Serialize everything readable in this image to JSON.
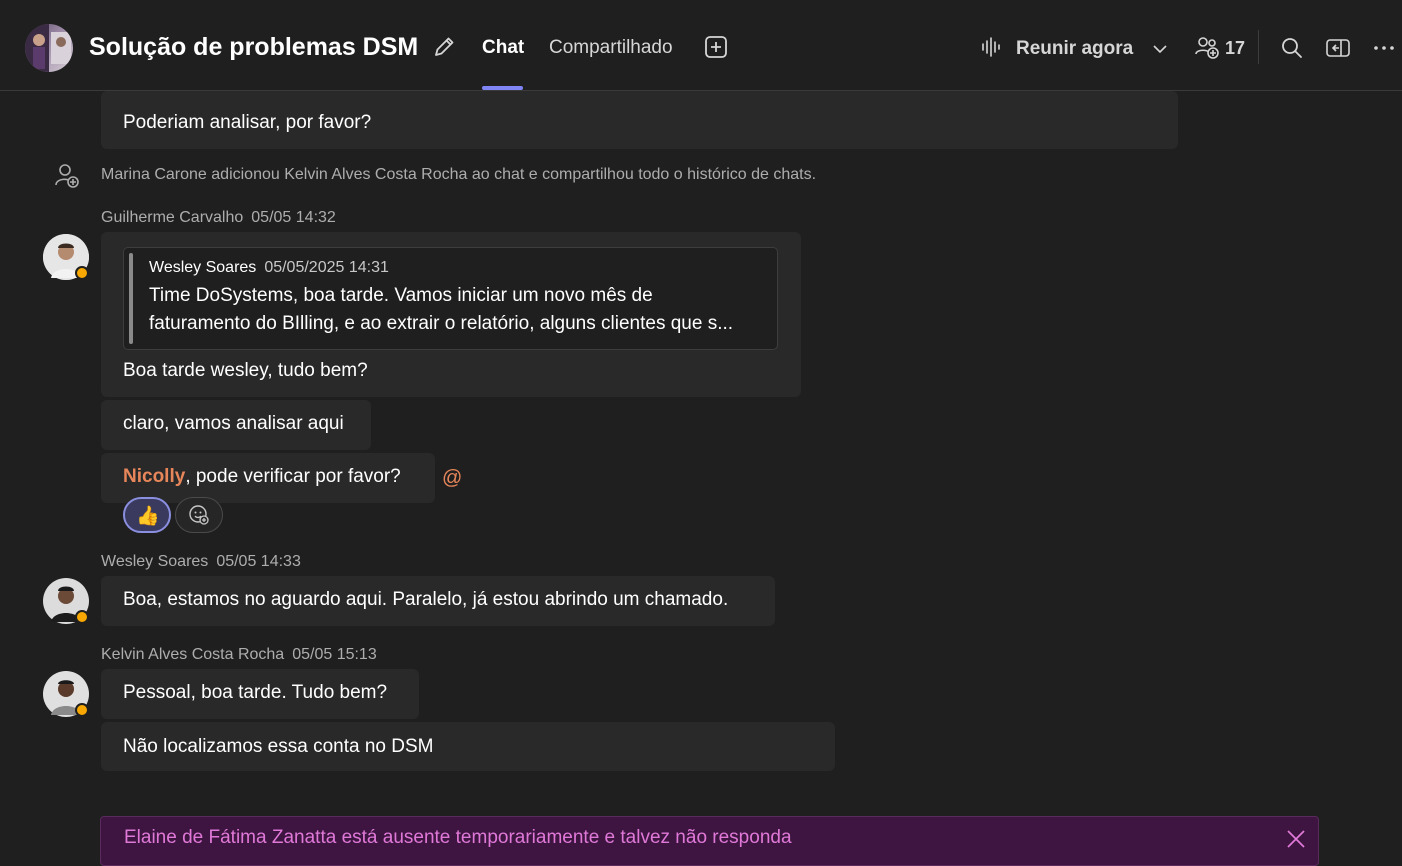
{
  "header": {
    "title": "Solução de problemas DSM",
    "tabs": [
      {
        "label": "Chat",
        "active": true
      },
      {
        "label": "Compartilhado",
        "active": false
      }
    ],
    "meet_label": "Reunir agora",
    "participants_count": "17",
    "icons": [
      "edit-icon",
      "add-tab-icon",
      "meet-now-icon",
      "chevron-down-icon",
      "people-icon",
      "search-icon",
      "popout-icon",
      "more-icon"
    ]
  },
  "messages": {
    "m0": {
      "text": "Poderiam analisar, por favor?"
    },
    "system": {
      "text": "Marina Carone adicionou Kelvin Alves Costa Rocha ao chat e compartilhou todo o histórico de chats."
    },
    "g1": {
      "sender": "Guilherme Carvalho",
      "time": "05/05 14:32",
      "quote": {
        "author": "Wesley Soares",
        "time": "05/05/2025 14:31",
        "line1": "Time DoSystems, boa tarde. Vamos iniciar um novo mês de",
        "line2": "faturamento do BIlling, e ao extrair o relatório, alguns clientes que s..."
      },
      "text": "Boa tarde wesley, tudo bem?",
      "text2": "claro, vamos analisar aqui",
      "mention": "Nicolly",
      "text3": ", pode verificar por favor?",
      "reaction_emoji": "👍"
    },
    "w1": {
      "sender": "Wesley Soares",
      "time": "05/05 14:33",
      "text": "Boa, estamos no aguardo aqui. Paralelo, já estou abrindo um chamado."
    },
    "k1": {
      "sender": "Kelvin Alves Costa Rocha",
      "time": "05/05 15:13",
      "text": "Pessoal, boa tarde. Tudo bem?",
      "text2": "Não localizamos essa conta no DSM"
    }
  },
  "banner": {
    "text": "Elaine de Fátima Zanatta está ausente temporariamente e talvez não responda"
  },
  "colors": {
    "accent": "#7f85f5",
    "mention": "#e7865a",
    "away": "#f8a800",
    "banner_bg": "#3d1540",
    "banner_text": "#e078d8"
  }
}
